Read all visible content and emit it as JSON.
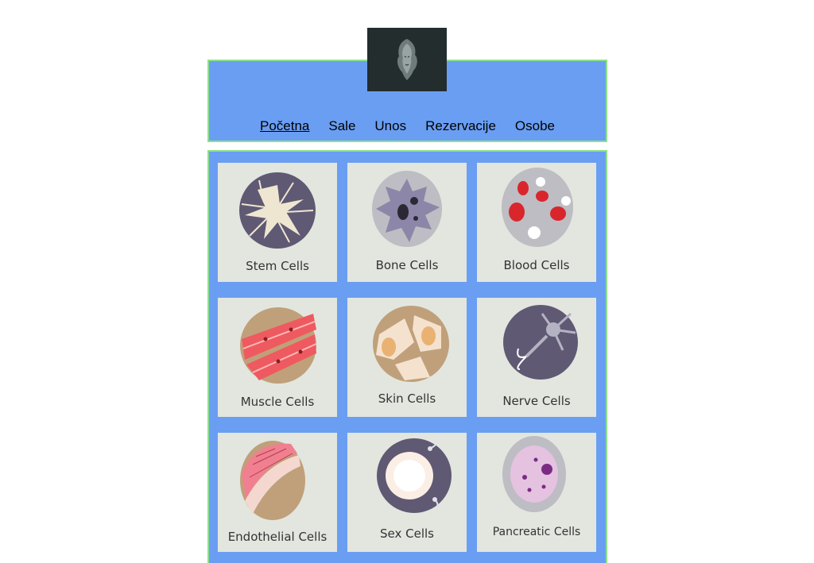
{
  "logo": {
    "icon": "lion-head-icon"
  },
  "nav": {
    "items": [
      {
        "label": "Početna",
        "active": true
      },
      {
        "label": "Sale",
        "active": false
      },
      {
        "label": "Unos",
        "active": false
      },
      {
        "label": "Rezervacije",
        "active": false
      },
      {
        "label": "Osobe",
        "active": false
      }
    ]
  },
  "cells": [
    {
      "label": "Stem Cells",
      "icon": "stem-cell-icon"
    },
    {
      "label": "Bone Cells",
      "icon": "bone-cell-icon"
    },
    {
      "label": "Blood Cells",
      "icon": "blood-cell-icon"
    },
    {
      "label": "Muscle Cells",
      "icon": "muscle-cell-icon"
    },
    {
      "label": "Skin Cells",
      "icon": "skin-cell-icon"
    },
    {
      "label": "Nerve Cells",
      "icon": "nerve-cell-icon"
    },
    {
      "label": "Endothelial Cells",
      "icon": "endothelial-cell-icon"
    },
    {
      "label": "Sex Cells",
      "icon": "sex-cell-icon"
    },
    {
      "label": "Pancreatic Cells",
      "icon": "pancreatic-cell-icon"
    }
  ],
  "colors": {
    "panel": "#6a9ef2",
    "panel_border": "#8ee08e",
    "card": "#e2e6df",
    "logo_bg": "#232d2e"
  }
}
